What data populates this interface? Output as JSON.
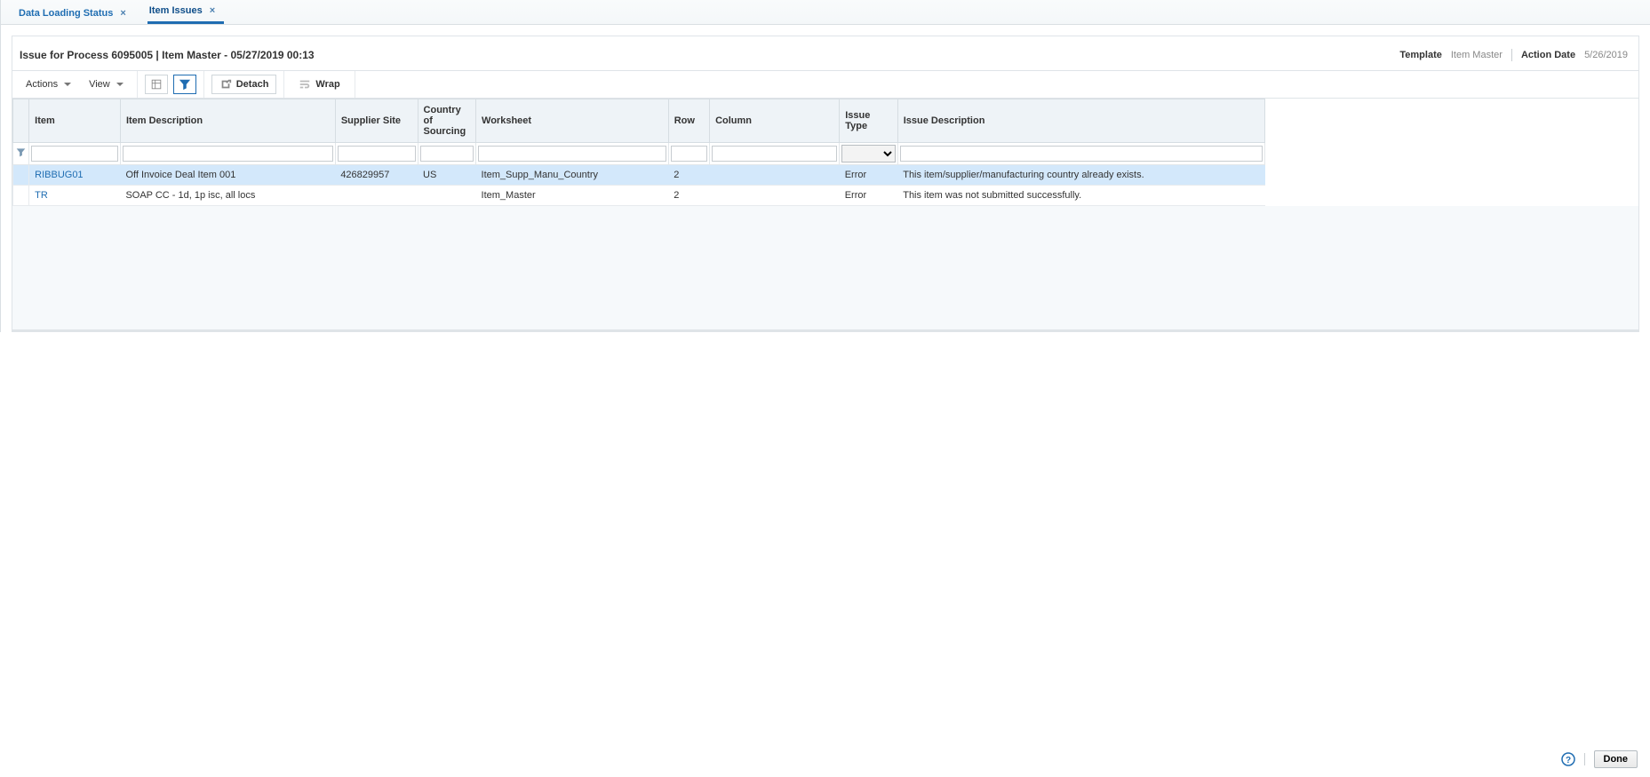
{
  "tabs": [
    {
      "label": "Data Loading Status",
      "active": false
    },
    {
      "label": "Item Issues",
      "active": true
    }
  ],
  "header": {
    "title": "Issue for Process  6095005 | Item Master - 05/27/2019 00:13",
    "template_label": "Template",
    "template_value": "Item Master",
    "action_date_label": "Action Date",
    "action_date_value": "5/26/2019"
  },
  "toolbar": {
    "actions": "Actions",
    "view": "View",
    "detach": "Detach",
    "wrap": "Wrap"
  },
  "columns": {
    "item": "Item",
    "item_description": "Item Description",
    "supplier_site": "Supplier Site",
    "country_of_sourcing": "Country of Sourcing",
    "worksheet": "Worksheet",
    "row": "Row",
    "column": "Column",
    "issue_type": "Issue Type",
    "issue_description": "Issue Description"
  },
  "rows": [
    {
      "item": "RIBBUG01",
      "item_description": "Off Invoice Deal Item 001",
      "supplier_site": "426829957",
      "country_of_sourcing": "US",
      "worksheet": "Item_Supp_Manu_Country",
      "row": "2",
      "column": "",
      "issue_type": "Error",
      "issue_description": "This item/supplier/manufacturing country already exists.",
      "selected": true
    },
    {
      "item": "TR",
      "item_description": "SOAP CC - 1d, 1p isc, all locs",
      "supplier_site": "",
      "country_of_sourcing": "",
      "worksheet": "Item_Master",
      "row": "2",
      "column": "",
      "issue_type": "Error",
      "issue_description": "This item was not submitted successfully.",
      "selected": false
    }
  ],
  "footer": {
    "done": "Done"
  }
}
